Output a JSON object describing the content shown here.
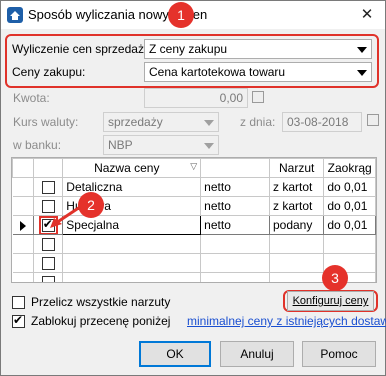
{
  "window": {
    "title": "Sposób wyliczania nowych cen"
  },
  "form": {
    "price_calc_label": "Wyliczenie cen sprzedaży:",
    "price_calc_value": "Z ceny zakupu",
    "purchase_price_label": "Ceny zakupu:",
    "purchase_price_value": "Cena kartotekowa towaru",
    "amount_label": "Kwota:",
    "amount_value": "0,00",
    "exchange_rate_label": "Kurs waluty:",
    "exchange_rate_value": "sprzedaży",
    "date_label": "z dnia:",
    "date_value": "03-08-2018",
    "bank_label": "w banku:",
    "bank_value": "NBP"
  },
  "grid": {
    "columns": [
      "Nazwa ceny",
      "Narzut",
      "Zaokrąg"
    ],
    "rows": [
      {
        "checked": false,
        "name": "Detaliczna",
        "type": "netto",
        "markup": "z kartot",
        "rounding": "do 0,01",
        "selected": false
      },
      {
        "checked": false,
        "name": "Hurtowa",
        "type": "netto",
        "markup": "z kartot",
        "rounding": "do 0,01",
        "selected": false
      },
      {
        "checked": true,
        "name": "Specjalna",
        "type": "netto",
        "markup": "podany",
        "rounding": "do 0,01",
        "selected": true
      },
      {
        "checked": false,
        "name": "",
        "type": "",
        "markup": "",
        "rounding": "",
        "selected": false
      },
      {
        "checked": false,
        "name": "",
        "type": "",
        "markup": "",
        "rounding": "",
        "selected": false
      },
      {
        "checked": false,
        "name": "",
        "type": "",
        "markup": "",
        "rounding": "",
        "selected": false
      }
    ]
  },
  "options": {
    "recalc_markups_label": "Przelicz wszystkie narzuty",
    "recalc_markups_checked": false,
    "configure_prices_label": "Konfiguruj ceny",
    "lock_label": "Zablokuj przecenę poniżej",
    "lock_checked": true,
    "lock_link": "minimalnej ceny z istniejących dostaw"
  },
  "buttons": {
    "ok": "OK",
    "cancel": "Anuluj",
    "help": "Pomoc"
  },
  "annotations": {
    "badge_1": "1",
    "badge_2": "2",
    "badge_3": "3"
  },
  "colors": {
    "annotation_red": "#e0322a",
    "link_blue": "#1a4fd1",
    "default_button_border": "#0078d7"
  }
}
